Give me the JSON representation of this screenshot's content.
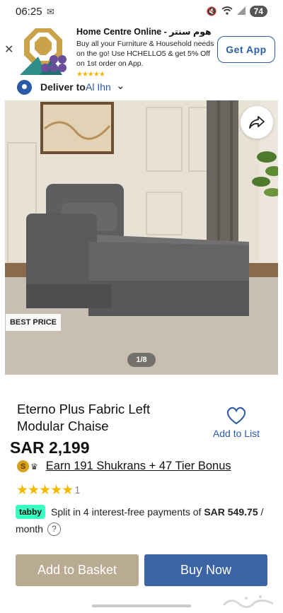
{
  "status_bar": {
    "time": "06:25",
    "mail_icon": "mail-icon",
    "battery": "74"
  },
  "banner": {
    "title": "Home Centre Online - هوم سنتر",
    "description": "Buy all your Furniture & Household needs on the go! Use HCHELLO5 & get 5% Off on 1st order on App.",
    "stars": "★★★★★",
    "cta": "Get App"
  },
  "delivery": {
    "label": "Deliver to",
    "city": "Al Ihn"
  },
  "gallery": {
    "badge": "BEST PRICE",
    "counter": "1/8"
  },
  "product": {
    "title": "Eterno Plus Fabric Left Modular Chaise",
    "wishlist_label": "Add to List",
    "price": "SAR 2,199",
    "shukran_text": "Earn 191 Shukrans + 47 Tier Bonus",
    "coin_letter": "S",
    "rating_stars": "★★★★★",
    "rating_count": "1"
  },
  "tabby": {
    "badge": "tabby",
    "text_before": "Split in 4 interest-free payments of ",
    "amount": "SAR 549.75",
    "text_after": " / month",
    "help": "?"
  },
  "actions": {
    "add_to_basket": "Add to Basket",
    "buy_now": "Buy Now"
  },
  "colors": {
    "brand_blue": "#3c63a3",
    "basket_beige": "#b9aa92",
    "star_gold": "#f5b800",
    "tabby_green": "#3bffc1"
  }
}
